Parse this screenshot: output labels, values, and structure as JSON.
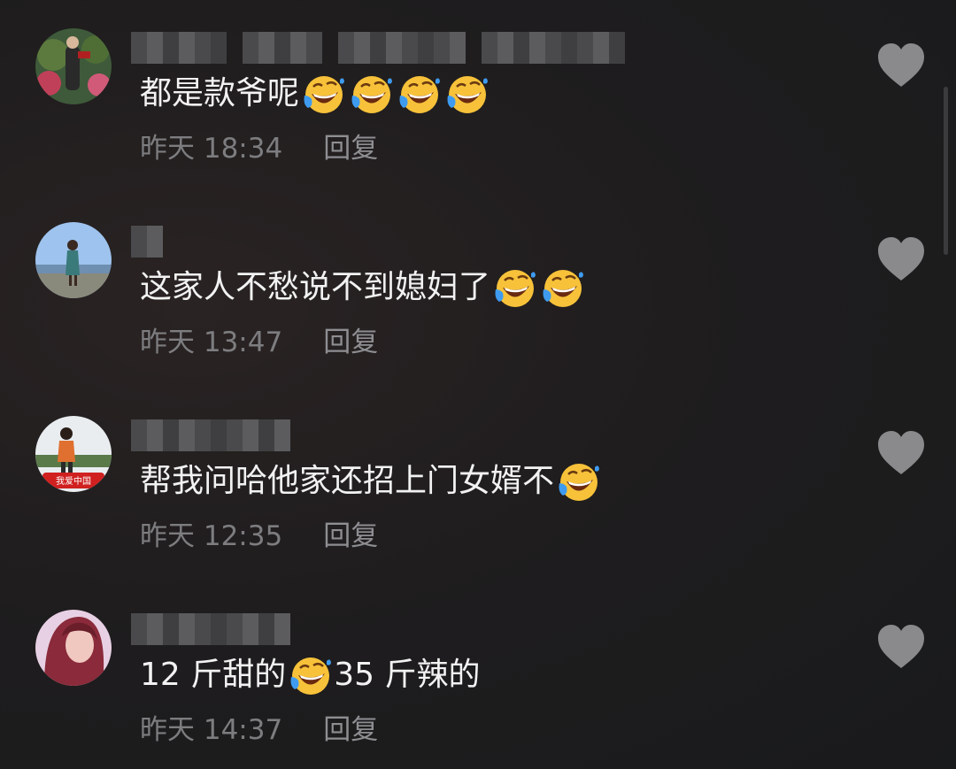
{
  "icons": {
    "like": "heart-icon",
    "emoji": "rofl-emoji-icon"
  },
  "colors": {
    "background": "#1c1c1e",
    "text": "#f2f2f2",
    "meta": "#7d7d80",
    "heart": "#8a8a8c",
    "emoji_face": "#f7c23a",
    "emoji_tear": "#3e9bf0"
  },
  "comments": [
    {
      "text_before": "都是款爷呢",
      "emoji_count": 4,
      "text_after": "",
      "time": "昨天 18:34",
      "reply_label": "回复"
    },
    {
      "text_before": "这家人不愁说不到媳妇了",
      "emoji_count": 2,
      "text_after": "",
      "time": "昨天 13:47",
      "reply_label": "回复"
    },
    {
      "text_before": "帮我问哈他家还招上门女婿不",
      "emoji_count": 1,
      "text_after": "",
      "time": "昨天 12:35",
      "reply_label": "回复"
    },
    {
      "text_before": "12 斤甜的",
      "emoji_count": 1,
      "text_after": "35 斤辣的",
      "time": "昨天 14:37",
      "reply_label": "回复"
    }
  ],
  "avatar_badge_3": "我爱中国"
}
